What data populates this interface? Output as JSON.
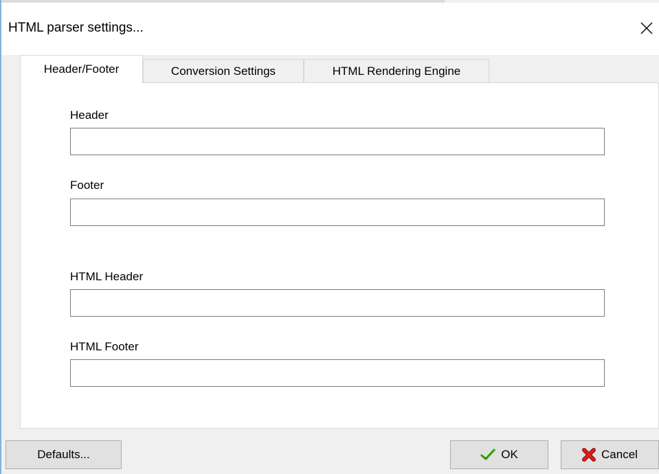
{
  "window": {
    "title": "HTML parser settings...",
    "close_icon": "close-icon"
  },
  "tabs": [
    {
      "label": "Header/Footer",
      "active": true
    },
    {
      "label": "Conversion Settings",
      "active": false
    },
    {
      "label": "HTML Rendering Engine",
      "active": false
    }
  ],
  "fields": {
    "header": {
      "label": "Header",
      "value": ""
    },
    "footer": {
      "label": "Footer",
      "value": ""
    },
    "html_header": {
      "label": "HTML Header",
      "value": ""
    },
    "html_footer": {
      "label": "HTML Footer",
      "value": ""
    }
  },
  "buttons": {
    "defaults": {
      "label": "Defaults..."
    },
    "ok": {
      "label": "OK",
      "icon": "checkmark-icon"
    },
    "cancel": {
      "label": "Cancel",
      "icon": "red-x-icon"
    }
  },
  "colors": {
    "ok_check": "#4caf1a",
    "cancel_x": "#d81e1e",
    "window_border": "#7fb6d4"
  }
}
